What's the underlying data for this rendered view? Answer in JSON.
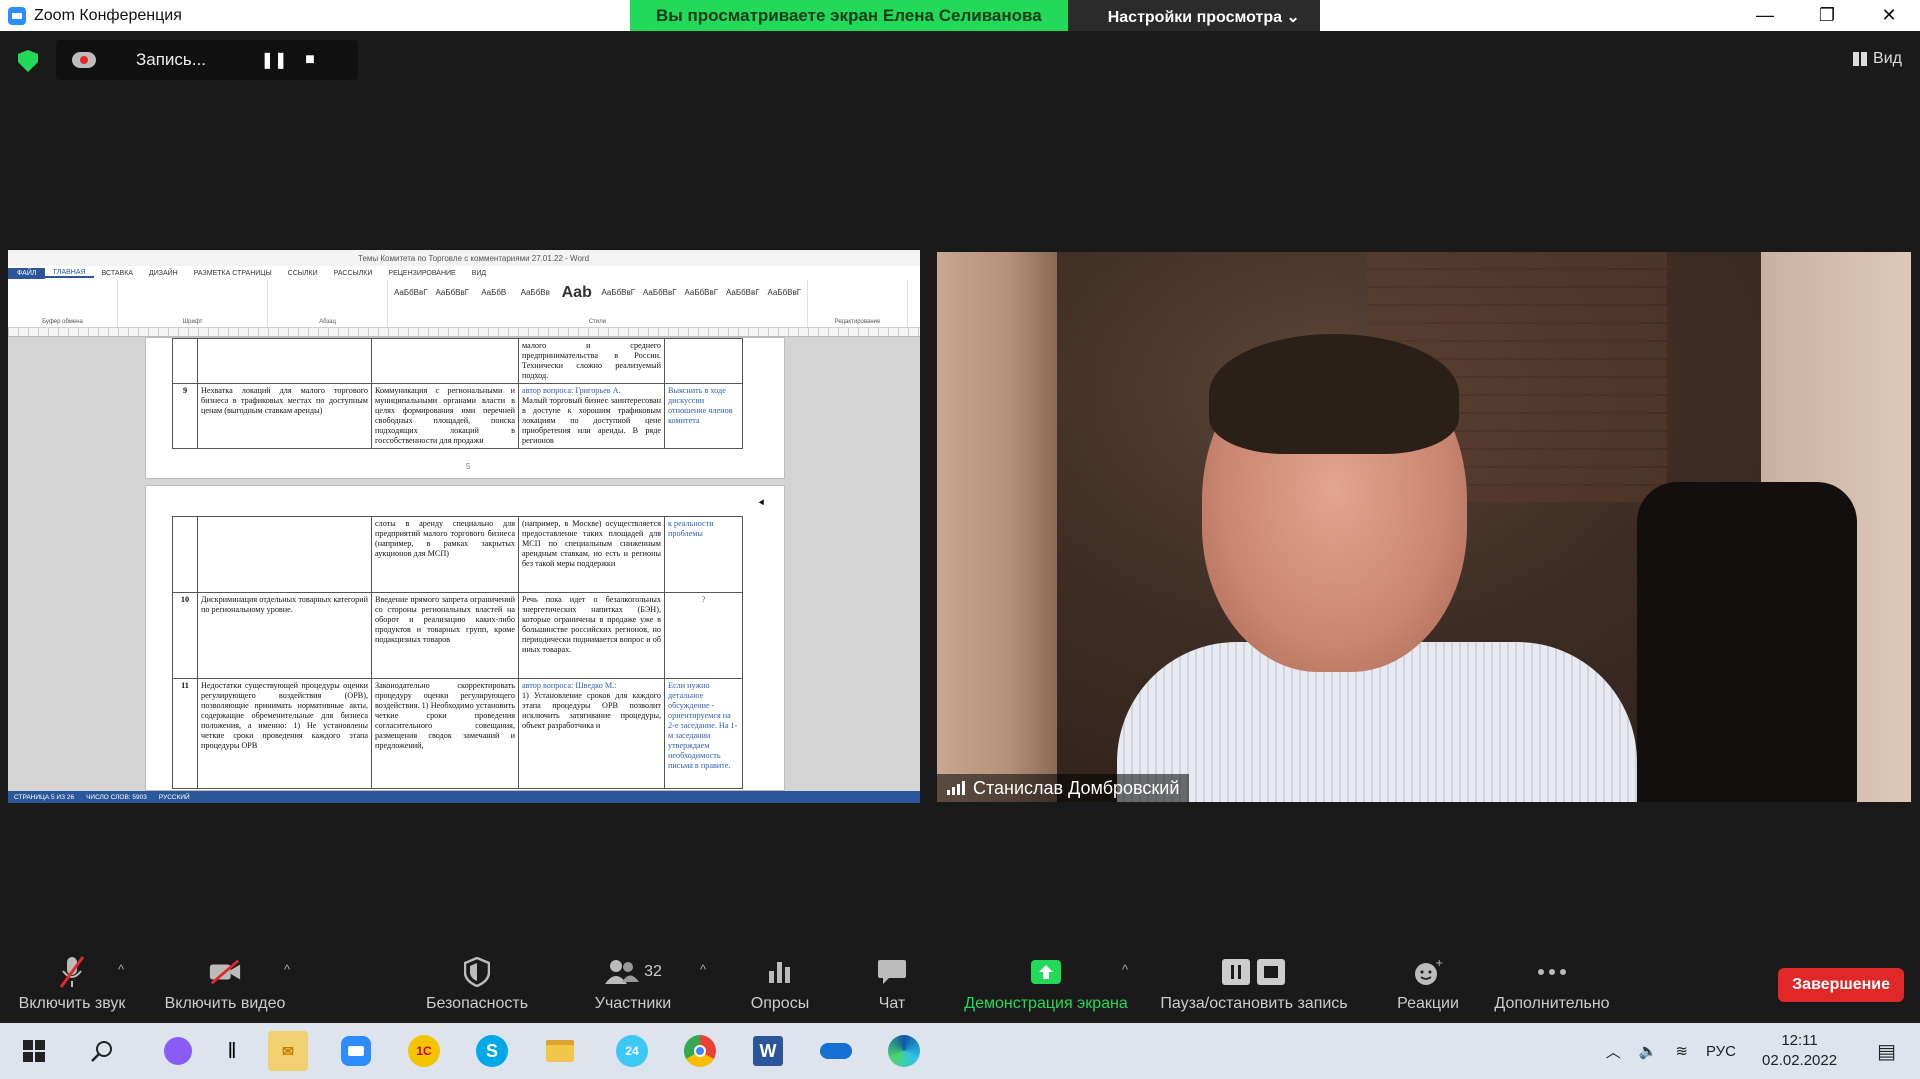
{
  "titlebar": {
    "title": "Zoom Конференция"
  },
  "share_banner": {
    "viewing": "Вы просматриваете экран Елена Селиванова",
    "settings": "Настройки просмотра ⌄"
  },
  "recording": {
    "label": "Запись..."
  },
  "view_button": {
    "label": "Вид"
  },
  "participant": {
    "name": "Станислав Домбровский"
  },
  "word": {
    "title": "Темы Комитета по Торговле с комментариями 27.01.22 - Word",
    "tabs": [
      "ФАЙЛ",
      "ГЛАВНАЯ",
      "ВСТАВКА",
      "ДИЗАЙН",
      "РАЗМЕТКА СТРАНИЦЫ",
      "ССЫЛКИ",
      "РАССЫЛКИ",
      "РЕЦЕНЗИРОВАНИЕ",
      "ВИД"
    ],
    "styles": [
      "АаБбВвГ",
      "АаБбВвГ",
      "АаБбВ",
      "АаБбВв",
      "Aab",
      "АаБбВвГ",
      "АаБбВвГ",
      "АаБбВвГ",
      "АаБбВвГ",
      "АаБбВвГ"
    ],
    "group_labels": [
      "Буфер обмена",
      "Шрифт",
      "Абзац",
      "Стили",
      "Редактирование"
    ],
    "status": [
      "СТРАНИЦА 5 ИЗ 26",
      "ЧИСЛО СЛОВ: 5903",
      "РУССКИЙ"
    ],
    "page_number": "5",
    "rows": [
      {
        "num": "",
        "c1": "",
        "c2": "",
        "c3": "малого и среднего предпринимательства в России. Технически сложно реализуемый подход.",
        "c4": ""
      },
      {
        "num": "9",
        "c1": "Нехватка локаций для малого торгового бизнеса в трафиковых местах по доступным ценам (выгодным ставкам аренды)",
        "c2": "Коммуникация с региональными и муниципальными органами власти в целях формирования ими перечней свободных площадей, поиска подходящих локаций в госсобственности для продажи",
        "c3_author": "автор вопроса: Григорьев А.",
        "c3": "Малый торговый бизнес заинтересован в доступе к хорошим трафиковым локациям по доступной цене приобретения или аренды. В ряде регионов",
        "c4": "Выяснить в ходе дискуссии отношение членов комитета"
      },
      {
        "num": "",
        "c1": "",
        "c2": "слоты в аренду специально для предприятий малого торгового бизнеса (например, в рамках закрытых аукционов для МСП)",
        "c3": "(например, в Москве) осуществляется предоставление таких площадей для МСП по специальным сниженным арендным ставкам, но есть и регионы без такой меры поддержки",
        "c4": "к реальности проблемы"
      },
      {
        "num": "10",
        "c1": "Дискриминация отдельных товарных категорий по региональному уровне.",
        "c2": "Введение прямого запрета ограничений со стороны региональных властей на оборот и реализацию каких-либо продуктов и товарных групп, кроме подакцизных товаров",
        "c3": "Речь пока идет о безалкогольных энергетических напитках (БЭН), которые ограничены в продаже уже в большинстве российских регионов, но периодически поднимается вопрос и об иных товарах.",
        "c4": "?"
      },
      {
        "num": "11",
        "c1": "Недостатки существующей процедуры оценки регулирующего воздействия (ОРВ), позволяющие принимать нормативные акты, содержащие обременительные для бизнеса положения, а именно: 1) Не установлены четкие сроки проведения каждого этапа процедуры ОРВ",
        "c2": "Законодательно скорректировать процедуру оценки регулирующего воздействия. 1) Необходимо установить четкие сроки проведения согласительного совещания, размещения сводок замечаний и предложений,",
        "c3_author": "автор вопроса: Шведко М.:",
        "c3": "1) Установление сроков для каждого этапа процедуры ОРВ позволит исключить затягивание процедуры, объект разработчика и",
        "c4": "Если нужно детальное обсуждение - ориентируемся на 2-е заседание. На 1-м заседании утверждаем необходимость письма в правите."
      }
    ]
  },
  "toolbar": {
    "audio": "Включить звук",
    "video": "Включить видео",
    "security": "Безопасность",
    "participants": "Участники",
    "participants_count": "32",
    "polls": "Опросы",
    "chat": "Чат",
    "share": "Демонстрация экрана",
    "record": "Пауза/остановить запись",
    "reactions": "Реакции",
    "more": "Дополнительно",
    "end": "Завершение"
  },
  "taskbar": {
    "lang": "РУС",
    "time": "12:11",
    "date": "02.02.2022",
    "apps": [
      "windows-start",
      "search",
      "cortana",
      "task-view",
      "outlook",
      "zoom",
      "1c",
      "skype",
      "explorer",
      "bitrix24",
      "chrome",
      "word",
      "onedrive",
      "edge"
    ]
  },
  "colors": {
    "share_green": "#23d959",
    "end_red": "#e02828",
    "word_blue": "#2b579a",
    "link_blue": "#2f5fb0"
  }
}
